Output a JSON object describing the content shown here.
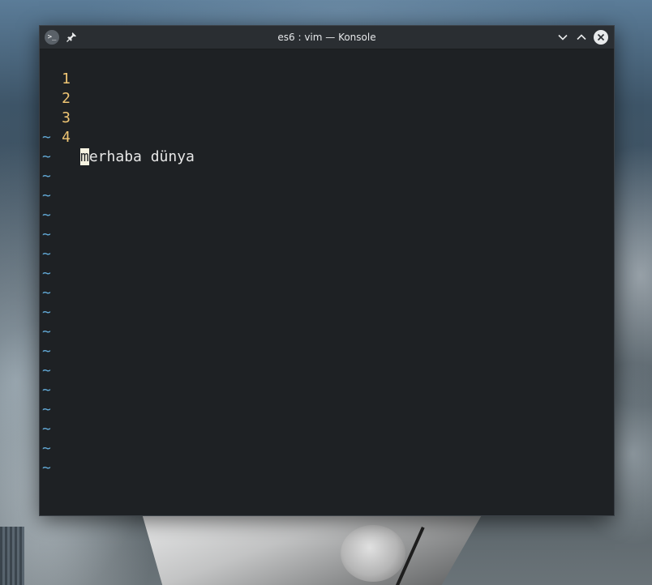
{
  "window": {
    "title": "es6 : vim — Konsole",
    "app_icon_glyph": ">_"
  },
  "vim": {
    "lines": [
      {
        "number": "1",
        "text": ""
      },
      {
        "number": "2",
        "text": ""
      },
      {
        "number": "3",
        "text": ""
      },
      {
        "number": "4",
        "cursor_char": "m",
        "text_rest": "erhaba dünya"
      }
    ],
    "tilde": "~",
    "tilde_count": 18
  },
  "colors": {
    "line_number": "#f0c674",
    "tilde": "#62a9d6",
    "cursor_bg": "#f6f3e1",
    "terminal_bg": "#1e2124"
  }
}
